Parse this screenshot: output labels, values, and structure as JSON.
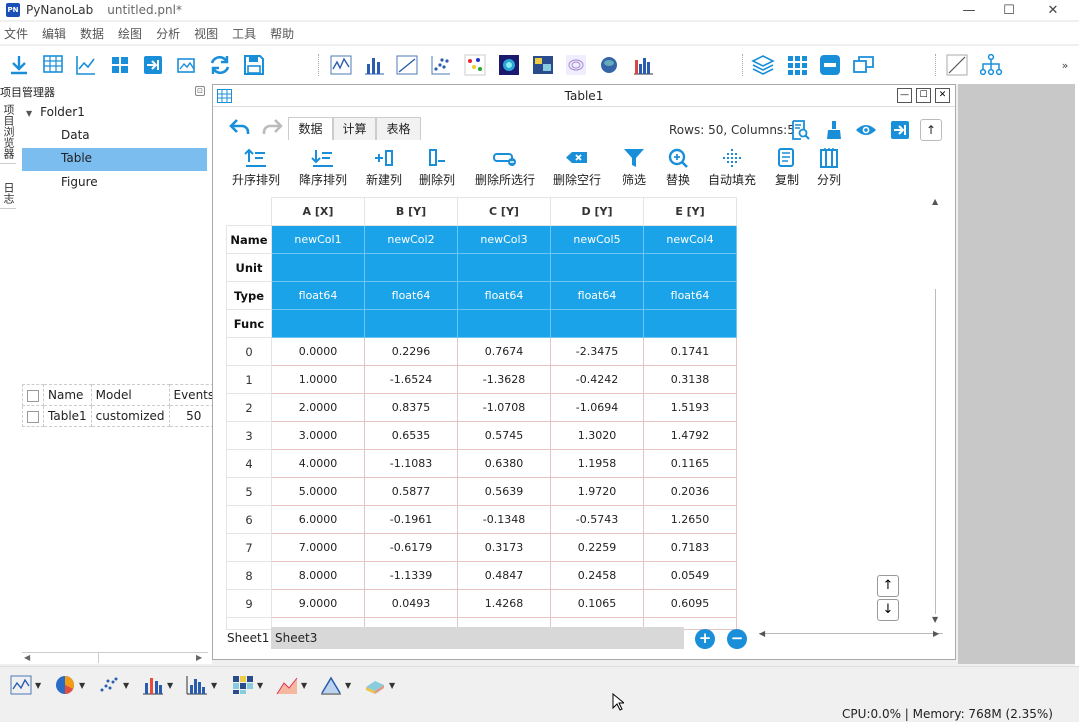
{
  "app": {
    "name": "PyNanoLab",
    "file": "untitled.pnl*"
  },
  "menu": [
    "文件",
    "编辑",
    "数据",
    "绘图",
    "分析",
    "视图",
    "工具",
    "帮助"
  ],
  "project": {
    "title": "项目管理器",
    "side_tabs": [
      "项目浏览器",
      "日志"
    ],
    "tree": {
      "folder": "Folder1",
      "items": [
        "Data",
        "Table",
        "Figure"
      ],
      "selected": "Table"
    },
    "mini_table": {
      "headers": [
        "Name",
        "Model",
        "Events"
      ],
      "rows": [
        [
          "Table1",
          "customized",
          "50"
        ]
      ]
    }
  },
  "table_window": {
    "title": "Table1",
    "tabs": [
      "数据",
      "计算",
      "表格"
    ],
    "active_tab": "数据",
    "rows_cols": "Rows: 50, Columns:5",
    "actions": [
      "升序排列",
      "降序排列",
      "新建列",
      "删除列",
      "删除所选行",
      "删除空行",
      "筛选",
      "替换",
      "自动填充",
      "复制",
      "分列"
    ],
    "columns": [
      "A [X]",
      "B [Y]",
      "C [Y]",
      "D [Y]",
      "E [Y]"
    ],
    "meta_labels": [
      "Name",
      "Unit",
      "Type",
      "Func"
    ],
    "meta": {
      "Name": [
        "newCol1",
        "newCol2",
        "newCol3",
        "newCol5",
        "newCol4"
      ],
      "Unit": [
        "",
        "",
        "",
        "",
        ""
      ],
      "Type": [
        "float64",
        "float64",
        "float64",
        "float64",
        "float64"
      ],
      "Func": [
        "",
        "",
        "",
        "",
        ""
      ]
    },
    "rows": [
      [
        "0",
        "0.0000",
        "0.2296",
        "0.7674",
        "-2.3475",
        "0.1741"
      ],
      [
        "1",
        "1.0000",
        "-1.6524",
        "-1.3628",
        "-0.4242",
        "0.3138"
      ],
      [
        "2",
        "2.0000",
        "0.8375",
        "-1.0708",
        "-1.0694",
        "1.5193"
      ],
      [
        "3",
        "3.0000",
        "0.6535",
        "0.5745",
        "1.3020",
        "1.4792"
      ],
      [
        "4",
        "4.0000",
        "-1.1083",
        "0.6380",
        "1.1958",
        "0.1165"
      ],
      [
        "5",
        "5.0000",
        "0.5877",
        "0.5639",
        "1.9720",
        "0.2036"
      ],
      [
        "6",
        "6.0000",
        "-0.1961",
        "-0.1348",
        "-0.5743",
        "1.2650"
      ],
      [
        "7",
        "7.0000",
        "-0.6179",
        "0.3173",
        "0.2259",
        "0.7183"
      ],
      [
        "8",
        "8.0000",
        "-1.1339",
        "0.4847",
        "0.2458",
        "0.0549"
      ],
      [
        "9",
        "9.0000",
        "0.0493",
        "1.4268",
        "0.1065",
        "0.6095"
      ]
    ],
    "sheets": [
      "Sheet1",
      "Sheet3"
    ],
    "active_sheet": "Sheet3"
  },
  "status": "CPU:0.0% | Memory: 768M (2.35%)",
  "colors": {
    "accent": "#1aa3e8",
    "icon_blue": "#1a8fd9",
    "selected": "#7cbdf0"
  }
}
